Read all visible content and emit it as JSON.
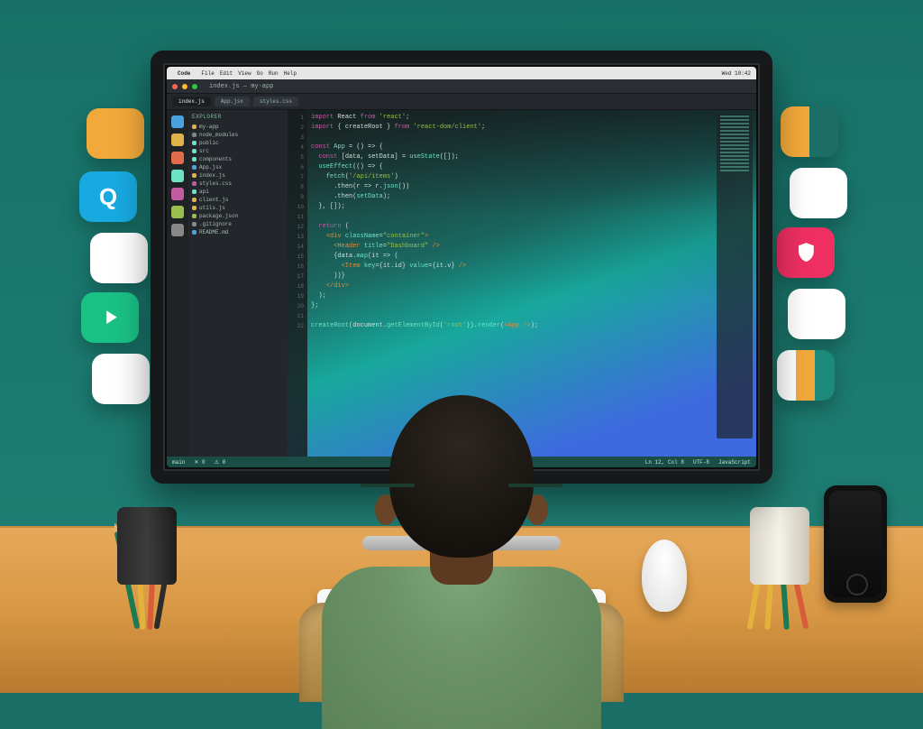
{
  "mac_menu": {
    "apple": "",
    "app": "Code",
    "items": [
      "File",
      "Edit",
      "View",
      "Go",
      "Run",
      "Help"
    ],
    "right": "Wed 10:42"
  },
  "window": {
    "title": "index.js — my-app",
    "tabs": [
      {
        "label": "index.js",
        "active": true
      },
      {
        "label": "App.jsx",
        "active": false
      },
      {
        "label": "styles.css",
        "active": false
      }
    ],
    "status": {
      "branch": "main",
      "errors": "0",
      "warnings": "0",
      "lang": "JavaScript",
      "enc": "UTF-8",
      "pos": "Ln 12, Col 8"
    }
  },
  "activity_icons": [
    "files",
    "search",
    "git",
    "debug",
    "ext",
    "account",
    "gear"
  ],
  "activity_colors": [
    "#4aa3df",
    "#e0b34a",
    "#e06c4a",
    "#6ee2c4",
    "#c15ca1",
    "#9bbf4d",
    "#888"
  ],
  "sidebar": {
    "title": "EXPLORER",
    "items": [
      {
        "label": "my-app",
        "c": "#e0b34a"
      },
      {
        "label": "node_modules",
        "c": "#7a8a86"
      },
      {
        "label": "public",
        "c": "#6ee2c4"
      },
      {
        "label": "src",
        "c": "#6ee2c4"
      },
      {
        "label": "components",
        "c": "#6ee2c4"
      },
      {
        "label": "App.jsx",
        "c": "#4aa3df"
      },
      {
        "label": "index.js",
        "c": "#e0b34a"
      },
      {
        "label": "styles.css",
        "c": "#c15ca1"
      },
      {
        "label": "api",
        "c": "#6ee2c4"
      },
      {
        "label": "client.js",
        "c": "#e0b34a"
      },
      {
        "label": "utils.js",
        "c": "#e0b34a"
      },
      {
        "label": "package.json",
        "c": "#9bbf4d"
      },
      {
        "label": ".gitignore",
        "c": "#888"
      },
      {
        "label": "README.md",
        "c": "#4aa3df"
      }
    ]
  },
  "code_lines": [
    {
      "n": "1",
      "h": "<span class='c4'>import</span> <span class='c3'>React</span> <span class='c4'>from</span> <span class='c5'>'react'</span>;"
    },
    {
      "n": "2",
      "h": "<span class='c4'>import</span> <span class='c3'>{ createRoot }</span> <span class='c4'>from</span> <span class='c5'>'react-dom/client'</span>;"
    },
    {
      "n": "3",
      "h": ""
    },
    {
      "n": "4",
      "h": "<span class='c4'>const</span> <span class='c2'>App</span> <span class='c3'>= () =&gt; {</span>"
    },
    {
      "n": "5",
      "h": "  <span class='c4'>const</span> <span class='c3'>[data, setData] =</span> <span class='c2'>useState</span><span class='c3'>([]);</span>"
    },
    {
      "n": "6",
      "h": "  <span class='c2'>useEffect</span><span class='c3'>(() =&gt; {</span>"
    },
    {
      "n": "7",
      "h": "    <span class='c2'>fetch</span><span class='c3'>(</span><span class='c5'>'/api/items'</span><span class='c3'>)</span>"
    },
    {
      "n": "8",
      "h": "      <span class='c3'>.then(r =&gt; r.</span><span class='c2'>json</span><span class='c3'>())</span>"
    },
    {
      "n": "9",
      "h": "      <span class='c3'>.then(</span><span class='c2'>setData</span><span class='c3'>);</span>"
    },
    {
      "n": "10",
      "h": "  <span class='c3'>}, []);</span>"
    },
    {
      "n": "11",
      "h": ""
    },
    {
      "n": "12",
      "h": "  <span class='c4'>return</span> <span class='c3'>(</span>"
    },
    {
      "n": "13",
      "h": "    <span class='c6'>&lt;div</span> <span class='c2'>className</span><span class='c3'>=</span><span class='c5'>\"container\"</span><span class='c6'>&gt;</span>"
    },
    {
      "n": "14",
      "h": "      <span class='c6'>&lt;Header</span> <span class='c2'>title</span><span class='c3'>=</span><span class='c5'>\"Dashboard\"</span> <span class='c6'>/&gt;</span>"
    },
    {
      "n": "15",
      "h": "      <span class='c3'>{data.</span><span class='c2'>map</span><span class='c3'>(it =&gt; (</span>"
    },
    {
      "n": "16",
      "h": "        <span class='c6'>&lt;Item</span> <span class='c2'>key</span><span class='c3'>={it.id}</span> <span class='c2'>value</span><span class='c3'>={it.v}</span> <span class='c6'>/&gt;</span>"
    },
    {
      "n": "17",
      "h": "      <span class='c3'>))}</span>"
    },
    {
      "n": "18",
      "h": "    <span class='c6'>&lt;/div&gt;</span>"
    },
    {
      "n": "19",
      "h": "  <span class='c3'>);</span>"
    },
    {
      "n": "20",
      "h": "<span class='c3'>};</span>"
    },
    {
      "n": "21",
      "h": ""
    },
    {
      "n": "22",
      "h": "<span class='c2'>createRoot</span><span class='c3'>(document.</span><span class='c2'>getElementById</span><span class='c3'>(</span><span class='c5'>'root'</span><span class='c3'>)).</span><span class='c2'>render</span><span class='c3'>(</span><span class='c6'>&lt;App /&gt;</span><span class='c3'>);</span>"
    }
  ],
  "tiles": {
    "left": [
      {
        "name": "tile-orange",
        "bg": "#f2a93b",
        "icon": ""
      },
      {
        "name": "tile-q",
        "bg": "#17a9e0",
        "icon": "Q"
      },
      {
        "name": "tile-blank-1",
        "bg": "#ffffff",
        "icon": ""
      },
      {
        "name": "tile-play",
        "bg": "#19c184",
        "icon": "play"
      },
      {
        "name": "tile-blank-2",
        "bg": "#ffffff",
        "icon": ""
      }
    ],
    "right": [
      {
        "name": "tile-duotone",
        "bg": "split",
        "icon": ""
      },
      {
        "name": "tile-blank-3",
        "bg": "#ffffff",
        "icon": ""
      },
      {
        "name": "tile-shield",
        "bg": "#ef2f62",
        "icon": "shield"
      },
      {
        "name": "tile-blank-4",
        "bg": "#ffffff",
        "icon": ""
      },
      {
        "name": "tile-stripe",
        "bg": "stripe",
        "icon": ""
      }
    ]
  }
}
